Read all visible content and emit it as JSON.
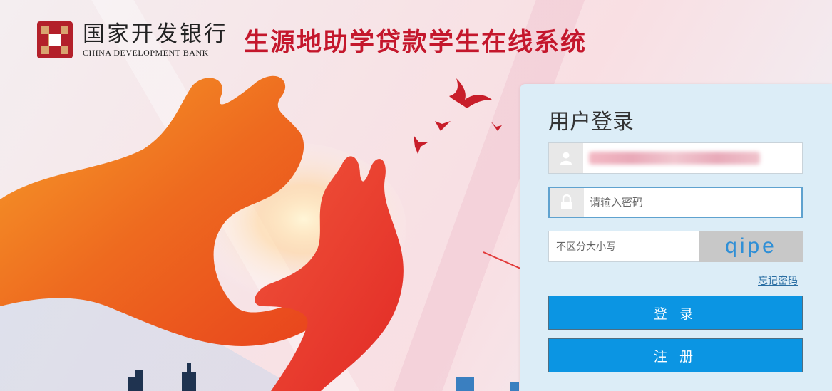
{
  "header": {
    "bank_name_cn": "国家开发银行",
    "bank_name_en": "CHINA DEVELOPMENT BANK",
    "system_title": "生源地助学贷款学生在线系统"
  },
  "login": {
    "title": "用户登录",
    "username": {
      "placeholder": "",
      "value_obscured": true
    },
    "password": {
      "placeholder": "请输入密码",
      "value": ""
    },
    "captcha": {
      "placeholder": "不区分大小写",
      "value": "",
      "image_text": "qipe"
    },
    "forgot_password": "忘记密码",
    "login_button": "登 录",
    "register_button": "注 册"
  },
  "colors": {
    "brand_red": "#c4172c",
    "button_blue": "#0b95e3",
    "panel_bg": "#dcedf7",
    "captcha_text": "#2f8fd6",
    "link": "#2a6ea3"
  },
  "icons": {
    "username_field": "user-icon",
    "password_field": "lock-icon",
    "annotation": "red-arrow-icon"
  }
}
